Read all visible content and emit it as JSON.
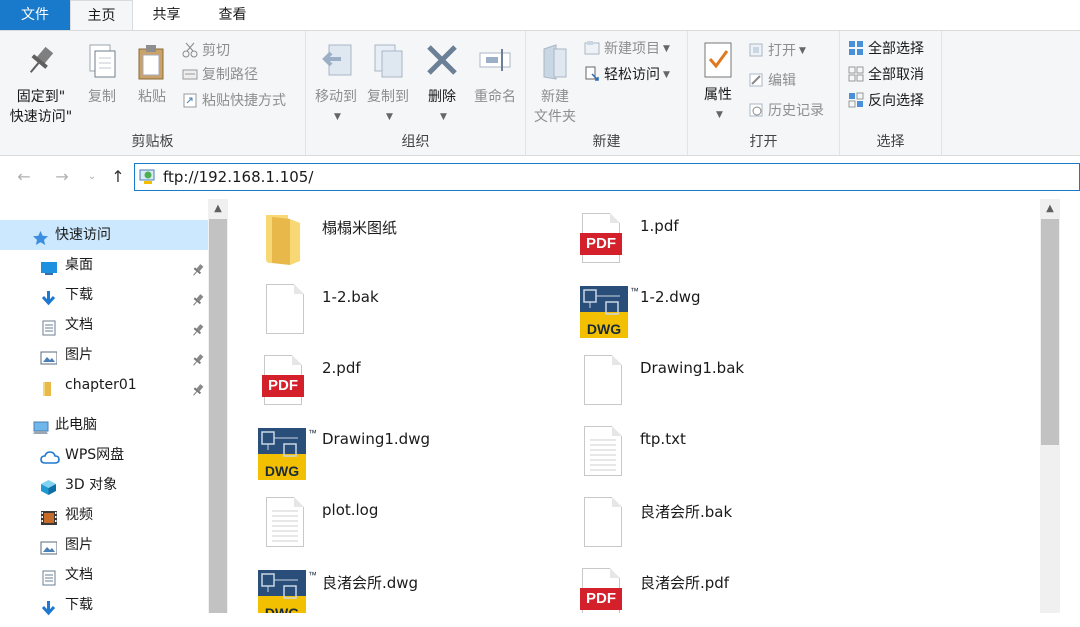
{
  "tabs": [
    {
      "label": "文件"
    },
    {
      "label": "主页"
    },
    {
      "label": "共享"
    },
    {
      "label": "查看"
    }
  ],
  "ribbon": {
    "clipboard": {
      "label": "剪贴板",
      "pin": "固定到\"\n快速访问\"",
      "pin_line1": "固定到\"",
      "pin_line2": "快速访问\"",
      "copy": "复制",
      "paste": "粘贴",
      "cut": "剪切",
      "copy_path": "复制路径",
      "paste_shortcut": "粘贴快捷方式"
    },
    "organize": {
      "label": "组织",
      "move_to": "移动到",
      "copy_to": "复制到",
      "delete": "删除",
      "rename": "重命名"
    },
    "new": {
      "label": "新建",
      "new_folder_line1": "新建",
      "new_folder_line2": "文件夹",
      "new_item": "新建项目",
      "easy_access": "轻松访问"
    },
    "open": {
      "label": "打开",
      "properties": "属性",
      "open": "打开",
      "edit": "编辑",
      "history": "历史记录"
    },
    "select": {
      "label": "选择",
      "select_all": "全部选择",
      "select_none": "全部取消",
      "invert": "反向选择"
    }
  },
  "address": {
    "path": "ftp://192.168.1.105/"
  },
  "nav": [
    {
      "label": "快速访问",
      "icon": "star-icon"
    },
    {
      "label": "桌面",
      "icon": "desktop-icon",
      "pinned": true
    },
    {
      "label": "下载",
      "icon": "download-icon",
      "pinned": true
    },
    {
      "label": "文档",
      "icon": "documents-icon",
      "pinned": true
    },
    {
      "label": "图片",
      "icon": "pictures-icon",
      "pinned": true
    },
    {
      "label": "chapter01",
      "icon": "folder-icon",
      "pinned": true
    },
    {
      "label": "此电脑",
      "icon": "computer-icon"
    },
    {
      "label": "WPS网盘",
      "icon": "cloud-icon"
    },
    {
      "label": "3D 对象",
      "icon": "3d-objects-icon"
    },
    {
      "label": "视频",
      "icon": "video-icon"
    },
    {
      "label": "图片",
      "icon": "pictures-icon"
    },
    {
      "label": "文档",
      "icon": "documents-icon"
    },
    {
      "label": "下载",
      "icon": "download-icon"
    }
  ],
  "files": [
    {
      "name": "榻榻米图纸",
      "icon": "folder-icon"
    },
    {
      "name": "1.pdf",
      "icon": "pdf-icon"
    },
    {
      "name": "1-2.bak",
      "icon": "blank-file-icon"
    },
    {
      "name": "1-2.dwg",
      "icon": "dwg-icon"
    },
    {
      "name": "2.pdf",
      "icon": "pdf-icon"
    },
    {
      "name": "Drawing1.bak",
      "icon": "blank-file-icon"
    },
    {
      "name": "Drawing1.dwg",
      "icon": "dwg-icon"
    },
    {
      "name": "ftp.txt",
      "icon": "text-file-icon"
    },
    {
      "name": "plot.log",
      "icon": "text-file-icon"
    },
    {
      "name": "良渚会所.bak",
      "icon": "blank-file-icon"
    },
    {
      "name": "良渚会所.dwg",
      "icon": "dwg-icon"
    },
    {
      "name": "良渚会所.pdf",
      "icon": "pdf-icon"
    }
  ],
  "labels": {
    "pdf_badge": "PDF",
    "dwg_badge": "DWG",
    "tm": "™"
  },
  "colors": {
    "accent": "#1979ca",
    "selection": "#cce8ff",
    "pdf_red": "#d4202a",
    "dwg_yellow": "#f2c000",
    "folder_yellow": "#f8d775"
  }
}
